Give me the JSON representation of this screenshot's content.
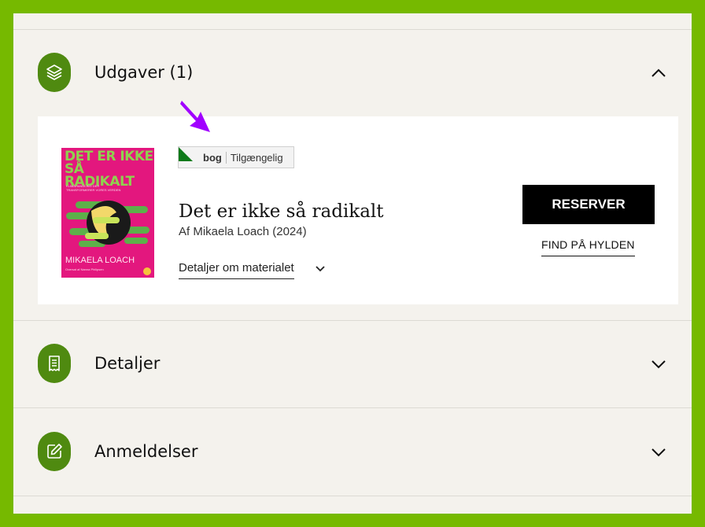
{
  "colors": {
    "frame": "#76b900",
    "page_bg": "#f4f2ed",
    "icon_circle": "#4f8a10",
    "availability_triangle": "#0e7a1a",
    "annotation_arrow": "#a100ff",
    "book_cover": "#e3177e"
  },
  "sections": {
    "editions": {
      "title": "Udgaver (1)",
      "icon": "layers-icon",
      "state": "expanded"
    },
    "details": {
      "title": "Detaljer",
      "icon": "receipt-icon",
      "state": "collapsed"
    },
    "reviews": {
      "title": "Anmeldelser",
      "icon": "edit-icon",
      "state": "collapsed"
    }
  },
  "edition": {
    "cover": {
      "title_line1": "DET ER IKKE",
      "title_line2": "SÅ RADIKALT",
      "subtitle": "KLIMAHANDLING DER TRANSFORMERER VORES VERDEN",
      "author": "MIKAELA LOACH",
      "translator": "Oversat af Nanna Philipsen"
    },
    "material_type": "bog",
    "availability": "Tilgængelig",
    "title": "Det er ikke så radikalt",
    "byline": "Af Mikaela Loach (2024)",
    "details_link": "Detaljer om materialet",
    "reserve_label": "RESERVER",
    "find_label": "FIND PÅ HYLDEN"
  }
}
